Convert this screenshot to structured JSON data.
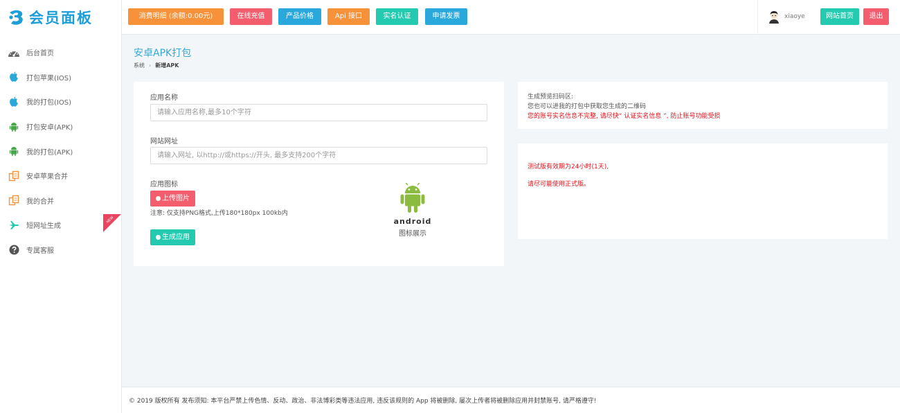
{
  "brand": {
    "name": "会员面板",
    "color": "#1e9ed8"
  },
  "sidebar": {
    "items": [
      {
        "label": "后台首页",
        "icon": "dashboard-icon"
      },
      {
        "label": "打包苹果(IOS)",
        "icon": "apple-icon"
      },
      {
        "label": "我的打包(IOS)",
        "icon": "apple-icon"
      },
      {
        "label": "打包安卓(APK)",
        "icon": "android-icon"
      },
      {
        "label": "我的打包(APK)",
        "icon": "android-icon"
      },
      {
        "label": "安卓苹果合并",
        "icon": "copy-icon"
      },
      {
        "label": "我的合并",
        "icon": "copy-icon"
      },
      {
        "label": "短网址生成",
        "icon": "plane-icon",
        "badge": "NEW"
      },
      {
        "label": "专属客服",
        "icon": "question-icon"
      }
    ]
  },
  "topbar": {
    "buttons": [
      {
        "label": "消费明细 (余额:0.00元)",
        "color": "#f7923a"
      },
      {
        "label": "在线充值",
        "color": "#f35d6e"
      },
      {
        "label": "产品价格",
        "color": "#2aa8dc"
      },
      {
        "label": "Api 接口",
        "color": "#f7923a"
      },
      {
        "label": "实名认证",
        "color": "#23cab0"
      },
      {
        "label": "申请发票",
        "color": "#2aa8dc"
      }
    ],
    "username": "xiaoye",
    "home_label": "网站首页",
    "logout_label": "退出"
  },
  "page": {
    "title": "安卓APK打包",
    "breadcrumb": [
      "系统",
      "新增APK"
    ]
  },
  "form": {
    "app_name_label": "应用名称",
    "app_name_placeholder": "请输入应用名称,最多10个字符",
    "site_url_label": "网站网址",
    "site_url_placeholder": "请输入网址, 以http://或https://开头, 最多支持200个字符",
    "icon_label": "应用图标",
    "upload_label": "上传图片",
    "upload_note": "注意: 仅支持PNG格式,上传180*180px 100kb内",
    "generate_label": "生成应用",
    "android_text": "android",
    "icon_caption": "图标展示"
  },
  "info": {
    "line1": "生成预览扫码区:",
    "line2": "您也可以进我的打包中获取您生成的二维码",
    "line3": "您的账号实名信息不完整, 请尽快“ 认证实名信息 ”, 防止账号功能受损"
  },
  "notice": {
    "line1": "测试版有效期为24小时(1天),",
    "line2": "请尽可能使用正式版。"
  },
  "footer": {
    "text": "© 2019 版权所有 发布须知: 本平台严禁上传色情、反动、政治、非法博彩类等违法应用, 违反该规则的 App 将被删除, 屡次上传者将被删除应用并封禁账号, 请严格遵守!"
  },
  "colors": {
    "red": "#f35d6e",
    "green": "#23cab0",
    "notice_red": "#e0131b",
    "title_blue": "#34a9d6"
  }
}
